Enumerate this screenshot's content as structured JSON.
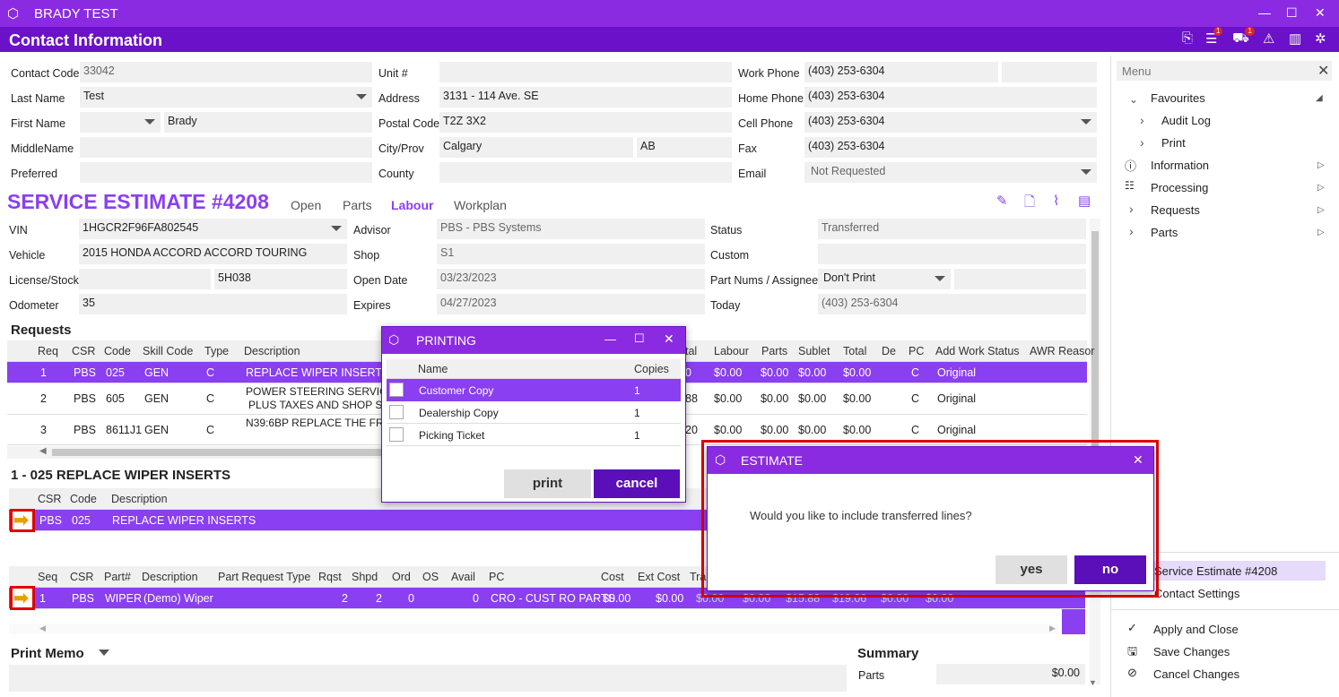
{
  "window": {
    "title": "BRADY TEST",
    "header": "Contact Information",
    "badge1": "1",
    "badge2": "1"
  },
  "contact": {
    "labels": {
      "code": "Contact Code",
      "last": "Last Name",
      "first": "First Name",
      "middle": "MiddleName",
      "preferred": "Preferred",
      "unit": "Unit #",
      "address": "Address",
      "postal": "Postal Code",
      "city": "City/Prov",
      "county": "County",
      "work": "Work Phone",
      "home": "Home Phone",
      "cell": "Cell Phone",
      "fax": "Fax",
      "email": "Email"
    },
    "code": "33042",
    "last": "Test",
    "first": "Brady",
    "address": "3131 - 114 Ave. SE",
    "postal": "T2Z 3X2",
    "city": "Calgary",
    "prov": "AB",
    "work": "(403) 253-6304",
    "home": "(403) 253-6304",
    "cell": "(403) 253-6304",
    "fax": "(403) 253-6304",
    "email": "Not Requested"
  },
  "estimate": {
    "title": "SERVICE ESTIMATE #4208",
    "tabs": [
      "Open",
      "Parts",
      "Labour",
      "Workplan"
    ],
    "labels": {
      "vin": "VIN",
      "vehicle": "Vehicle",
      "license": "License/Stock",
      "odometer": "Odometer",
      "advisor": "Advisor",
      "shop": "Shop",
      "open": "Open Date",
      "expires": "Expires",
      "status": "Status",
      "custom": "Custom",
      "partnums": "Part Nums / Assignee",
      "today": "Today"
    },
    "vin": "1HGCR2F96FA802545",
    "vehicle": "2015 HONDA ACCORD ACCORD TOURING",
    "stock": "5H038",
    "odometer": "35",
    "advisor": "PBS - PBS Systems",
    "shop": "S1",
    "open": "03/23/2023",
    "expires": "04/27/2023",
    "status": "Transferred",
    "partnums": "Don't Print",
    "today": "(403) 253-6304"
  },
  "requests": {
    "title": "Requests",
    "headers": [
      "Req",
      "CSR",
      "Code",
      "Skill Code",
      "Type",
      "Description",
      "tal",
      "Labour",
      "Parts",
      "Sublet",
      "Total",
      "De",
      "PC",
      "Add Work Status",
      "AWR Reasor"
    ],
    "rows": [
      {
        "req": "1",
        "csr": "PBS",
        "code": "025",
        "skill": "GEN",
        "type": "C",
        "desc": "REPLACE WIPER INSERTS",
        "desc2": "",
        "tal": "0",
        "labour": "$0.00",
        "parts": "$0.00",
        "sublet": "$0.00",
        "total": "$0.00",
        "pc": "C",
        "status": "Original"
      },
      {
        "req": "2",
        "csr": "PBS",
        "code": "605",
        "skill": "GEN",
        "type": "C",
        "desc": "POWER STEERING SERVICE $",
        "desc2": "PLUS TAXES AND SHOP SUP",
        "tal": "88",
        "labour": "$0.00",
        "parts": "$0.00",
        "sublet": "$0.00",
        "total": "$0.00",
        "pc": "C",
        "status": "Original"
      },
      {
        "req": "3",
        "csr": "PBS",
        "code": "8611J1",
        "skill": "GEN",
        "type": "C",
        "desc": "N39:6BP REPLACE THE FRON",
        "desc2": "",
        "tal": "20",
        "labour": "$0.00",
        "parts": "$0.00",
        "sublet": "$0.00",
        "total": "$0.00",
        "pc": "C",
        "status": "Original"
      }
    ]
  },
  "detail": {
    "title": "1 - 025 REPLACE WIPER INSERTS",
    "headers": [
      "CSR",
      "Code",
      "Description"
    ],
    "row": {
      "csr": "PBS",
      "code": "025",
      "desc": "REPLACE WIPER INSERTS"
    }
  },
  "parts": {
    "headers": [
      "Seq",
      "CSR",
      "Part#",
      "Description",
      "Part Request Type",
      "Rqst",
      "Shpd",
      "Ord",
      "OS",
      "Avail",
      "PC",
      "Cost",
      "Ext Cost",
      "Tra"
    ],
    "row": {
      "seq": "1",
      "csr": "PBS",
      "part": "WIPER",
      "desc": "(Demo) Wiper",
      "rqst": "2",
      "shpd": "2",
      "ord": "0",
      "avail": "0",
      "pc": "CRO - CUST RO PARTS",
      "cost": "$0.00",
      "ext": "$0.00",
      "c1": "$0.00",
      "c2": "$0.00",
      "c3": "$15.88",
      "c4": "$19.06",
      "c5": "$0.00",
      "c6": "$0.00"
    }
  },
  "memo": {
    "title": "Print Memo"
  },
  "summary": {
    "title": "Summary",
    "parts_label": "Parts",
    "parts_value": "$0.00"
  },
  "menu": {
    "title": "Menu",
    "favourites": "Favourites",
    "fav_items": [
      "Audit Log",
      "Print"
    ],
    "items": [
      "Information",
      "Processing",
      "Requests",
      "Parts"
    ],
    "open_items": [
      "Service Estimate #4208",
      "Contact Settings"
    ],
    "actions": [
      "Apply and Close",
      "Save Changes",
      "Cancel Changes"
    ]
  },
  "printing": {
    "title": "PRINTING",
    "headers": [
      "Name",
      "Copies"
    ],
    "rows": [
      {
        "name": "Customer Copy",
        "copies": "1"
      },
      {
        "name": "Dealership Copy",
        "copies": "1"
      },
      {
        "name": "Picking Ticket",
        "copies": "1"
      }
    ],
    "print": "print",
    "cancel": "cancel"
  },
  "estimate_dialog": {
    "title": "ESTIMATE",
    "message": "Would you like to include transferred lines?",
    "yes": "yes",
    "no": "no"
  },
  "colors": {
    "accent": "#8a2be2",
    "header": "#6a11c9",
    "select": "#8a3ff0",
    "highlight": "#e00000"
  }
}
